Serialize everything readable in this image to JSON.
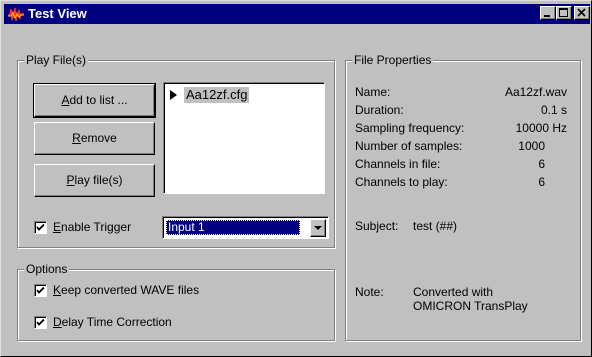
{
  "window": {
    "title": "Test View",
    "icons": {
      "app": "waveform-icon",
      "minimize": "minimize-icon",
      "maximize": "maximize-icon",
      "close": "close-icon"
    }
  },
  "play_files": {
    "group_label": "Play File(s)",
    "add_button": {
      "mnemonic": "A",
      "rest": "dd to list ..."
    },
    "remove_button": {
      "mnemonic": "R",
      "rest": "emove"
    },
    "play_button": {
      "mnemonic": "P",
      "rest": "lay file(s)"
    },
    "files": [
      {
        "name": "Aa12zf.cfg",
        "selected": true
      }
    ],
    "enable_trigger": {
      "checked": true,
      "mnemonic": "E",
      "rest": "nable Trigger"
    },
    "trigger_select": {
      "value": "Input 1"
    }
  },
  "options": {
    "group_label": "Options",
    "keep_wave": {
      "checked": true,
      "mnemonic": "K",
      "rest": "eep converted WAVE files"
    },
    "delay_correction": {
      "checked": true,
      "mnemonic": "D",
      "rest": "elay Time Correction"
    }
  },
  "file_properties": {
    "group_label": "File Properties",
    "rows": [
      {
        "label": "Name:",
        "value": "Aa12zf.wav"
      },
      {
        "label": "Duration:",
        "value": "0.1 s"
      },
      {
        "label": "Sampling frequency:",
        "value": "10000 Hz"
      },
      {
        "label": "Number of samples:",
        "value": "1000"
      },
      {
        "label": "Channels in file:",
        "value": "6"
      },
      {
        "label": "Channels to play:",
        "value": "6"
      }
    ],
    "subject": {
      "label": "Subject:",
      "value": "test (##)"
    },
    "note": {
      "label": "Note:",
      "line1": "Converted with",
      "line2": "OMICRON TransPlay"
    }
  },
  "colors": {
    "titlebar": "#000080",
    "face": "#c0c0c0",
    "highlight": "#000080"
  }
}
